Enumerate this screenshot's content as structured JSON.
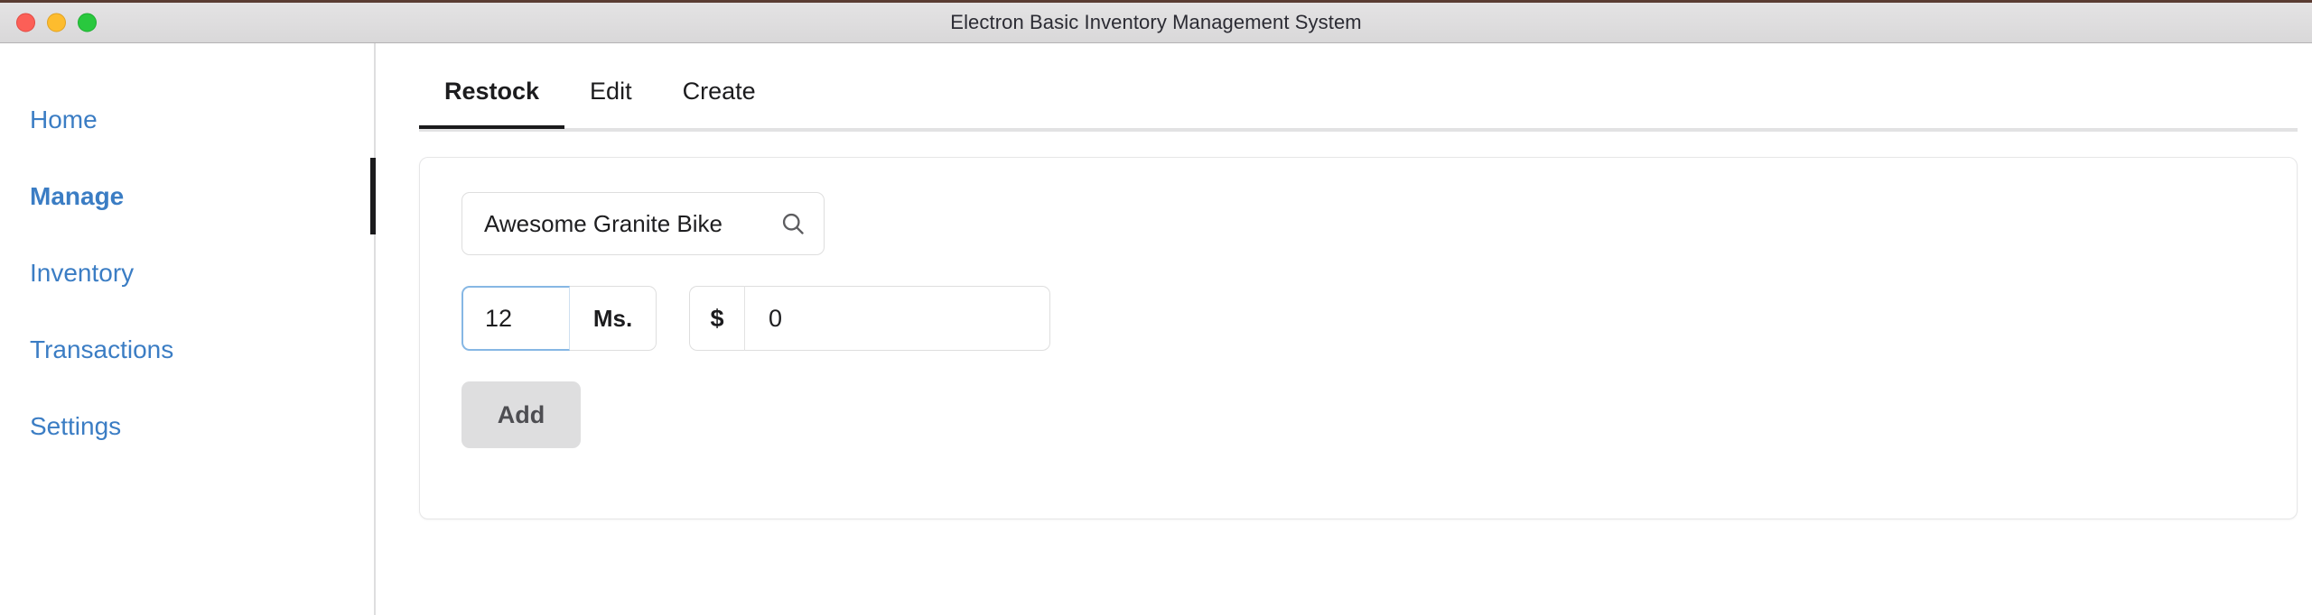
{
  "window": {
    "title": "Electron Basic Inventory Management System",
    "controls": {
      "close": "close-button",
      "minimize": "minimize-button",
      "maximize": "maximize-button"
    },
    "colors": {
      "close": "#fc5f57",
      "minimize": "#fdbc2e",
      "maximize": "#29c83e",
      "titlebar_bg": "#dedcde",
      "link_blue": "#3b7dc4",
      "active_dark": "#1a1a1c",
      "focus_blue": "#86b7e4",
      "button_gray": "#dededf"
    }
  },
  "sidebar": {
    "items": [
      {
        "label": "Home",
        "active": false
      },
      {
        "label": "Manage",
        "active": true
      },
      {
        "label": "Inventory",
        "active": false
      },
      {
        "label": "Transactions",
        "active": false
      },
      {
        "label": "Settings",
        "active": false
      }
    ]
  },
  "main": {
    "tabs": [
      {
        "label": "Restock",
        "active": true
      },
      {
        "label": "Edit",
        "active": false
      },
      {
        "label": "Create",
        "active": false
      }
    ],
    "form": {
      "search": {
        "value": "Awesome Granite Bike",
        "placeholder": "Search product",
        "icon": "search-icon"
      },
      "quantity": {
        "value": "12",
        "placeholder": "0",
        "unit_label": "Ms."
      },
      "price": {
        "value": "0",
        "placeholder": "0",
        "currency_symbol": "$"
      },
      "submit_label": "Add"
    }
  }
}
